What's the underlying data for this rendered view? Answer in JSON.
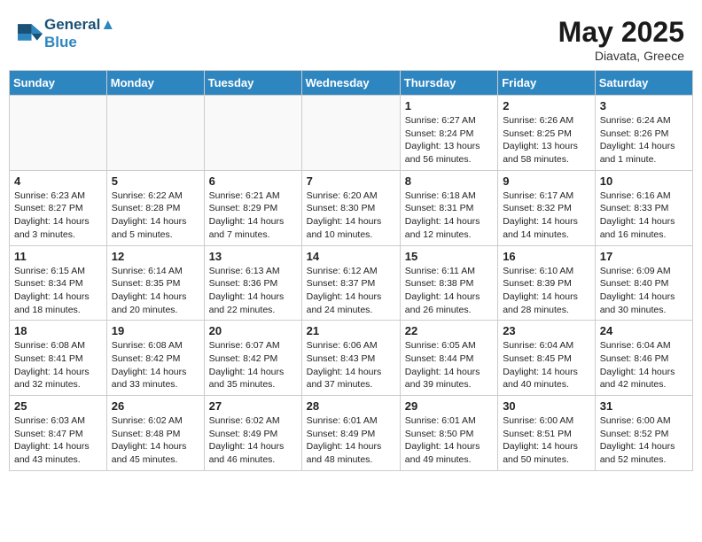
{
  "header": {
    "logo_line1": "General",
    "logo_line2": "Blue",
    "month": "May 2025",
    "location": "Diavata, Greece"
  },
  "weekdays": [
    "Sunday",
    "Monday",
    "Tuesday",
    "Wednesday",
    "Thursday",
    "Friday",
    "Saturday"
  ],
  "weeks": [
    [
      {
        "day": "",
        "info": ""
      },
      {
        "day": "",
        "info": ""
      },
      {
        "day": "",
        "info": ""
      },
      {
        "day": "",
        "info": ""
      },
      {
        "day": "1",
        "info": "Sunrise: 6:27 AM\nSunset: 8:24 PM\nDaylight: 13 hours\nand 56 minutes."
      },
      {
        "day": "2",
        "info": "Sunrise: 6:26 AM\nSunset: 8:25 PM\nDaylight: 13 hours\nand 58 minutes."
      },
      {
        "day": "3",
        "info": "Sunrise: 6:24 AM\nSunset: 8:26 PM\nDaylight: 14 hours\nand 1 minute."
      }
    ],
    [
      {
        "day": "4",
        "info": "Sunrise: 6:23 AM\nSunset: 8:27 PM\nDaylight: 14 hours\nand 3 minutes."
      },
      {
        "day": "5",
        "info": "Sunrise: 6:22 AM\nSunset: 8:28 PM\nDaylight: 14 hours\nand 5 minutes."
      },
      {
        "day": "6",
        "info": "Sunrise: 6:21 AM\nSunset: 8:29 PM\nDaylight: 14 hours\nand 7 minutes."
      },
      {
        "day": "7",
        "info": "Sunrise: 6:20 AM\nSunset: 8:30 PM\nDaylight: 14 hours\nand 10 minutes."
      },
      {
        "day": "8",
        "info": "Sunrise: 6:18 AM\nSunset: 8:31 PM\nDaylight: 14 hours\nand 12 minutes."
      },
      {
        "day": "9",
        "info": "Sunrise: 6:17 AM\nSunset: 8:32 PM\nDaylight: 14 hours\nand 14 minutes."
      },
      {
        "day": "10",
        "info": "Sunrise: 6:16 AM\nSunset: 8:33 PM\nDaylight: 14 hours\nand 16 minutes."
      }
    ],
    [
      {
        "day": "11",
        "info": "Sunrise: 6:15 AM\nSunset: 8:34 PM\nDaylight: 14 hours\nand 18 minutes."
      },
      {
        "day": "12",
        "info": "Sunrise: 6:14 AM\nSunset: 8:35 PM\nDaylight: 14 hours\nand 20 minutes."
      },
      {
        "day": "13",
        "info": "Sunrise: 6:13 AM\nSunset: 8:36 PM\nDaylight: 14 hours\nand 22 minutes."
      },
      {
        "day": "14",
        "info": "Sunrise: 6:12 AM\nSunset: 8:37 PM\nDaylight: 14 hours\nand 24 minutes."
      },
      {
        "day": "15",
        "info": "Sunrise: 6:11 AM\nSunset: 8:38 PM\nDaylight: 14 hours\nand 26 minutes."
      },
      {
        "day": "16",
        "info": "Sunrise: 6:10 AM\nSunset: 8:39 PM\nDaylight: 14 hours\nand 28 minutes."
      },
      {
        "day": "17",
        "info": "Sunrise: 6:09 AM\nSunset: 8:40 PM\nDaylight: 14 hours\nand 30 minutes."
      }
    ],
    [
      {
        "day": "18",
        "info": "Sunrise: 6:08 AM\nSunset: 8:41 PM\nDaylight: 14 hours\nand 32 minutes."
      },
      {
        "day": "19",
        "info": "Sunrise: 6:08 AM\nSunset: 8:42 PM\nDaylight: 14 hours\nand 33 minutes."
      },
      {
        "day": "20",
        "info": "Sunrise: 6:07 AM\nSunset: 8:42 PM\nDaylight: 14 hours\nand 35 minutes."
      },
      {
        "day": "21",
        "info": "Sunrise: 6:06 AM\nSunset: 8:43 PM\nDaylight: 14 hours\nand 37 minutes."
      },
      {
        "day": "22",
        "info": "Sunrise: 6:05 AM\nSunset: 8:44 PM\nDaylight: 14 hours\nand 39 minutes."
      },
      {
        "day": "23",
        "info": "Sunrise: 6:04 AM\nSunset: 8:45 PM\nDaylight: 14 hours\nand 40 minutes."
      },
      {
        "day": "24",
        "info": "Sunrise: 6:04 AM\nSunset: 8:46 PM\nDaylight: 14 hours\nand 42 minutes."
      }
    ],
    [
      {
        "day": "25",
        "info": "Sunrise: 6:03 AM\nSunset: 8:47 PM\nDaylight: 14 hours\nand 43 minutes."
      },
      {
        "day": "26",
        "info": "Sunrise: 6:02 AM\nSunset: 8:48 PM\nDaylight: 14 hours\nand 45 minutes."
      },
      {
        "day": "27",
        "info": "Sunrise: 6:02 AM\nSunset: 8:49 PM\nDaylight: 14 hours\nand 46 minutes."
      },
      {
        "day": "28",
        "info": "Sunrise: 6:01 AM\nSunset: 8:49 PM\nDaylight: 14 hours\nand 48 minutes."
      },
      {
        "day": "29",
        "info": "Sunrise: 6:01 AM\nSunset: 8:50 PM\nDaylight: 14 hours\nand 49 minutes."
      },
      {
        "day": "30",
        "info": "Sunrise: 6:00 AM\nSunset: 8:51 PM\nDaylight: 14 hours\nand 50 minutes."
      },
      {
        "day": "31",
        "info": "Sunrise: 6:00 AM\nSunset: 8:52 PM\nDaylight: 14 hours\nand 52 minutes."
      }
    ]
  ]
}
